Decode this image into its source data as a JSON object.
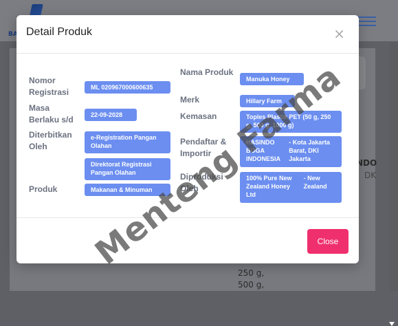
{
  "background": {
    "logo_text": "BA",
    "text_right_1": "NDO",
    "text_right_2": "DK",
    "text_below": [
      "250 g,",
      "500 g,"
    ]
  },
  "modal": {
    "title": "Detail Produk",
    "close_symbol": "×",
    "close_button": "Close"
  },
  "fields_left": [
    {
      "label": "Nomor Registrasi",
      "value": "ML 020967000600635"
    },
    {
      "label": "Masa Berlaku s/d",
      "value": "22-09-2028"
    },
    {
      "label": "Diterbitkan Oleh",
      "values": [
        "e-Registration Pangan Olahan",
        "Direktorat Registrasi Pangan Olahan"
      ]
    },
    {
      "label": "Produk",
      "value": "Makanan & Minuman"
    }
  ],
  "fields_right": [
    {
      "label": "Nama Produk",
      "value": "Manuka Honey"
    },
    {
      "label": "Merk",
      "value": "Hillary Farm"
    },
    {
      "label": "Kemasan",
      "value": "Toples Plastik PET (50 g, 250 g, 500 g, 1000 g)"
    },
    {
      "label": "Pendaftar & Importir",
      "value_a": "HASINDO BOGA INDONESIA",
      "value_b": "- Kota Jakarta Barat, DKI Jakarta"
    },
    {
      "label": "Diproduksi Oleh",
      "value_a": "100% Pure New Zealand Honey Ltd",
      "value_b": "- New Zealand"
    }
  ],
  "watermark": "Menteng Farma",
  "colors": {
    "pill": "#6b8ef0",
    "close_button": "#f0306e"
  }
}
